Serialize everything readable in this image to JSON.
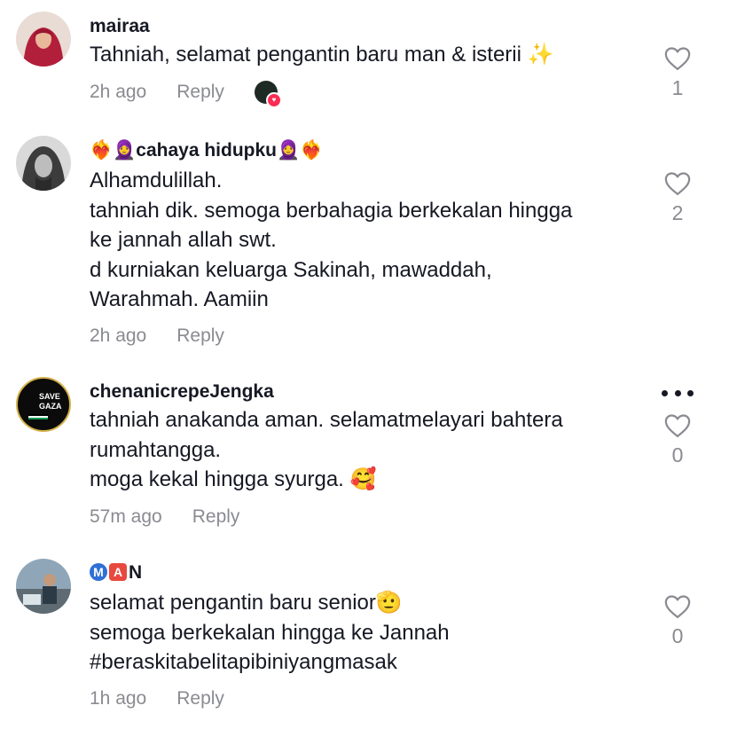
{
  "comments": [
    {
      "username": "mairaa",
      "lines": [
        "Tahniah, selamat pengantin baru man & isterii ✨"
      ],
      "time": "2h ago",
      "reply": "Reply",
      "likes": "1"
    },
    {
      "username": "❤️‍🔥🧕cahaya hidupku🧕❤️‍🔥",
      "lines": [
        "Alhamdulillah.",
        "tahniah dik. semoga berbahagia berkekalan hingga",
        "ke jannah allah swt.",
        "d kurniakan keluarga Sakinah, mawaddah,",
        "Warahmah. Aamiin"
      ],
      "time": "2h ago",
      "reply": "Reply",
      "likes": "2"
    },
    {
      "username": "chenanicrepeJengka",
      "avatar_text": [
        "SAVE",
        "GAZA"
      ],
      "lines": [
        "tahniah anakanda aman. selamatmelayari bahtera",
        "rumahtangga.",
        "moga kekal hingga syurga. 🥰"
      ],
      "time": "57m ago",
      "reply": "Reply",
      "likes": "0"
    },
    {
      "username_letters": [
        "M",
        "A",
        "N"
      ],
      "lines": [
        "selamat pengantin baru senior🫡",
        "semoga berkekalan hingga ke Jannah",
        "#beraskitabelitapibiniyangmasak"
      ],
      "time": "1h ago",
      "reply": "Reply",
      "likes": "0"
    }
  ],
  "icons": {
    "like": "heart-outline-icon",
    "more": "more-options-icon"
  },
  "colors": {
    "text": "#161823",
    "muted": "#8a8b91",
    "heart_badge": "#fe2c55",
    "circled_m": "#2f6fd6",
    "squared_a": "#e8483e"
  }
}
